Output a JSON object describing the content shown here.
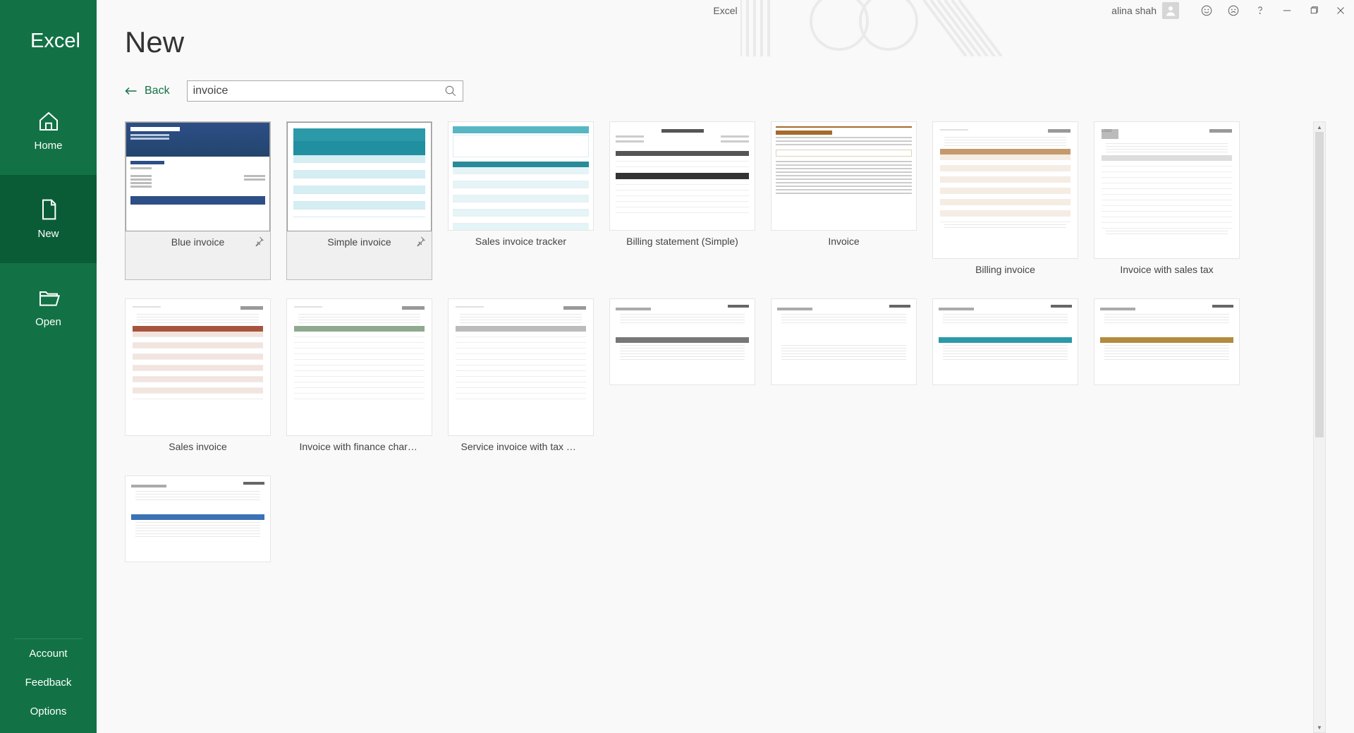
{
  "app": {
    "title": "Excel",
    "window_title": "Excel"
  },
  "titlebar": {
    "user_name": "alina shah"
  },
  "sidebar": {
    "items": [
      {
        "id": "home",
        "label": "Home"
      },
      {
        "id": "new",
        "label": "New",
        "selected": true
      },
      {
        "id": "open",
        "label": "Open"
      }
    ],
    "bottom": [
      {
        "id": "account",
        "label": "Account"
      },
      {
        "id": "feedback",
        "label": "Feedback"
      },
      {
        "id": "options",
        "label": "Options"
      }
    ]
  },
  "page": {
    "title": "New",
    "back_label": "Back",
    "search_value": "invoice"
  },
  "templates": [
    {
      "id": "blue-invoice",
      "label": "Blue invoice",
      "row": 1,
      "pinned": true,
      "hovered": true,
      "preview": "blue"
    },
    {
      "id": "simple-invoice",
      "label": "Simple invoice",
      "row": 1,
      "pinned": true,
      "hovered": true,
      "preview": "teal"
    },
    {
      "id": "sales-tracker",
      "label": "Sales invoice tracker",
      "row": 1,
      "pinned": false,
      "hovered": false,
      "preview": "teal2"
    },
    {
      "id": "billing-simple",
      "label": "Billing statement (Simple)",
      "row": 1,
      "pinned": false,
      "hovered": false,
      "preview": "grey"
    },
    {
      "id": "invoice",
      "label": "Invoice",
      "row": 1,
      "pinned": false,
      "hovered": false,
      "preview": "orange"
    },
    {
      "id": "billing-invoice",
      "label": "Billing invoice",
      "row": 2,
      "pinned": false,
      "hovered": false,
      "preview": "doc-orange"
    },
    {
      "id": "sales-tax",
      "label": "Invoice with sales tax",
      "row": 2,
      "pinned": false,
      "hovered": false,
      "preview": "doc-plain"
    },
    {
      "id": "sales-invoice",
      "label": "Sales invoice",
      "row": 2,
      "pinned": false,
      "hovered": false,
      "preview": "doc-red"
    },
    {
      "id": "finance-charge",
      "label": "Invoice with finance charg...",
      "row": 2,
      "pinned": false,
      "hovered": false,
      "preview": "doc-green"
    },
    {
      "id": "service-tax",
      "label": "Service invoice with tax ca...",
      "row": 2,
      "pinned": false,
      "hovered": false,
      "preview": "doc-grey"
    },
    {
      "id": "r3-1",
      "label": "",
      "row": 3,
      "pinned": false,
      "hovered": false,
      "preview": "short-dgrey"
    },
    {
      "id": "r3-2",
      "label": "",
      "row": 3,
      "pinned": false,
      "hovered": false,
      "preview": "short-plain"
    },
    {
      "id": "r3-3",
      "label": "",
      "row": 3,
      "pinned": false,
      "hovered": false,
      "preview": "short-teal"
    },
    {
      "id": "r3-4",
      "label": "",
      "row": 3,
      "pinned": false,
      "hovered": false,
      "preview": "short-gold"
    },
    {
      "id": "r3-5",
      "label": "",
      "row": 3,
      "pinned": false,
      "hovered": false,
      "preview": "short-blue"
    }
  ]
}
